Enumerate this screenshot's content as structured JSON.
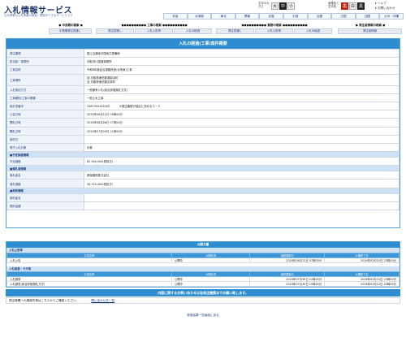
{
  "header": {
    "logo": "入札情報サービス",
    "tagline": "公共事業の入札情報の検索・閲覧ができるサービスです",
    "font_size_label": "文字の大きさ",
    "font_sizes": [
      "大",
      "中",
      "小"
    ],
    "color_label": "画像色と文字色",
    "color_options": [
      "黒",
      "白",
      "黒"
    ],
    "help": "ヘルプ",
    "inquiry": "お問い合わせ"
  },
  "regions": [
    "本省",
    "北海道",
    "東北",
    "関東",
    "北陸",
    "中部",
    "近畿",
    "中国",
    "四国",
    "九州・沖縄"
  ],
  "nav": {
    "groups": [
      {
        "title": "● 中長期の検索 ●",
        "items": [
          "中長期発注見通し"
        ]
      },
      {
        "title": "●●●●●●●●●● 工事の検索 ●●●●●●●●●●",
        "items": [
          "発注見通し",
          "入札公告等",
          "入札の経過"
        ]
      },
      {
        "title": "●●●●●●●●●● 業務の検索 ●●●●●●●●●●",
        "items": [
          "発注見通し",
          "入札公告等",
          "入札の経過"
        ]
      },
      {
        "title": "● 発注者情報の検索 ●",
        "items": [
          "発注者情報"
        ]
      }
    ]
  },
  "detail": {
    "title": "入札の経過(工事)案件概要",
    "rows": [
      {
        "type": "row",
        "label": "発注機関",
        "value": "国土交通省中国地方整備局"
      },
      {
        "type": "row",
        "label": "担当部・事務所",
        "value": "鳥取河川国道事務所"
      },
      {
        "type": "row",
        "label": "工事名称",
        "value": "令和6年度倉吉道路改良(北条東)工事"
      },
      {
        "type": "row2",
        "label": "工事場所",
        "value": "自:鳥取県東伯郡湯梨浜町",
        "value2": "至:鳥取県東伯郡北栄町"
      },
      {
        "type": "row",
        "label": "入札契約方式",
        "value": "一般競争入札(総合評価落札方式)"
      },
      {
        "type": "row",
        "label": "工事種別/工事の業種",
        "value": "一般土木工事"
      },
      {
        "type": "row",
        "label": "設計書番号",
        "value": "2487304103009",
        "value_note": "※発注機関が独自に決めるコード"
      },
      {
        "type": "row",
        "label": "公告日時",
        "value": "2024年06月12日 09時00分"
      },
      {
        "type": "row",
        "label": "開札日時",
        "value": "2024年06月26日 17時00分"
      },
      {
        "type": "row",
        "label": "開札日時",
        "value": "2024年07月24日 11時00分"
      },
      {
        "type": "row",
        "label": "契約日",
        "value": ""
      },
      {
        "type": "row",
        "label": "電子入札対象",
        "value": "対象"
      },
      {
        "type": "sec",
        "label": "■予定価格情報"
      },
      {
        "type": "row",
        "label": "予定価格",
        "value": "62,560,000(税抜き)"
      },
      {
        "type": "sec",
        "label": "■落札者情報"
      },
      {
        "type": "row",
        "label": "落札者名",
        "value": "美保建設株式会社"
      },
      {
        "type": "row",
        "label": "落札価格",
        "value": "56,750,000(税抜き)"
      },
      {
        "type": "sec",
        "label": "■契約情報"
      },
      {
        "type": "row",
        "label": "契約者名",
        "value": ""
      },
      {
        "type": "row",
        "label": "契約金額",
        "value": ""
      }
    ]
  },
  "documents": {
    "title": "公開文書",
    "headers": [
      "文書名称",
      "公開状況",
      "最終更新日",
      "公開終了日"
    ],
    "sections": [
      {
        "name": "入札公告等",
        "rows": [
          {
            "name": "入札公告",
            "status": "公開中",
            "updated": "2024年06月12日 07時00分",
            "end": "2026年03月31日 23時00分"
          }
        ]
      },
      {
        "name": "入札経過・その他",
        "rows": [
          {
            "name": "入札調書",
            "status": "公開中",
            "updated": "2024年07月30日 10時45分",
            "end": "2026年03月31日 23時00分"
          },
          {
            "name": "入札調書(総合評価落札方式)",
            "status": "公開中",
            "updated": "2024年07月30日 10時45分",
            "end": "2026年03月31日 23時00分"
          }
        ]
      }
    ]
  },
  "notice": "内容に関するお問い合わせは各発注機関までお願い致します。",
  "contact": {
    "label": "発注機関への連絡先等はこちらからご確認ください。",
    "link": "問い合わせ先一覧"
  },
  "back": "検索結果一覧画面に戻る"
}
